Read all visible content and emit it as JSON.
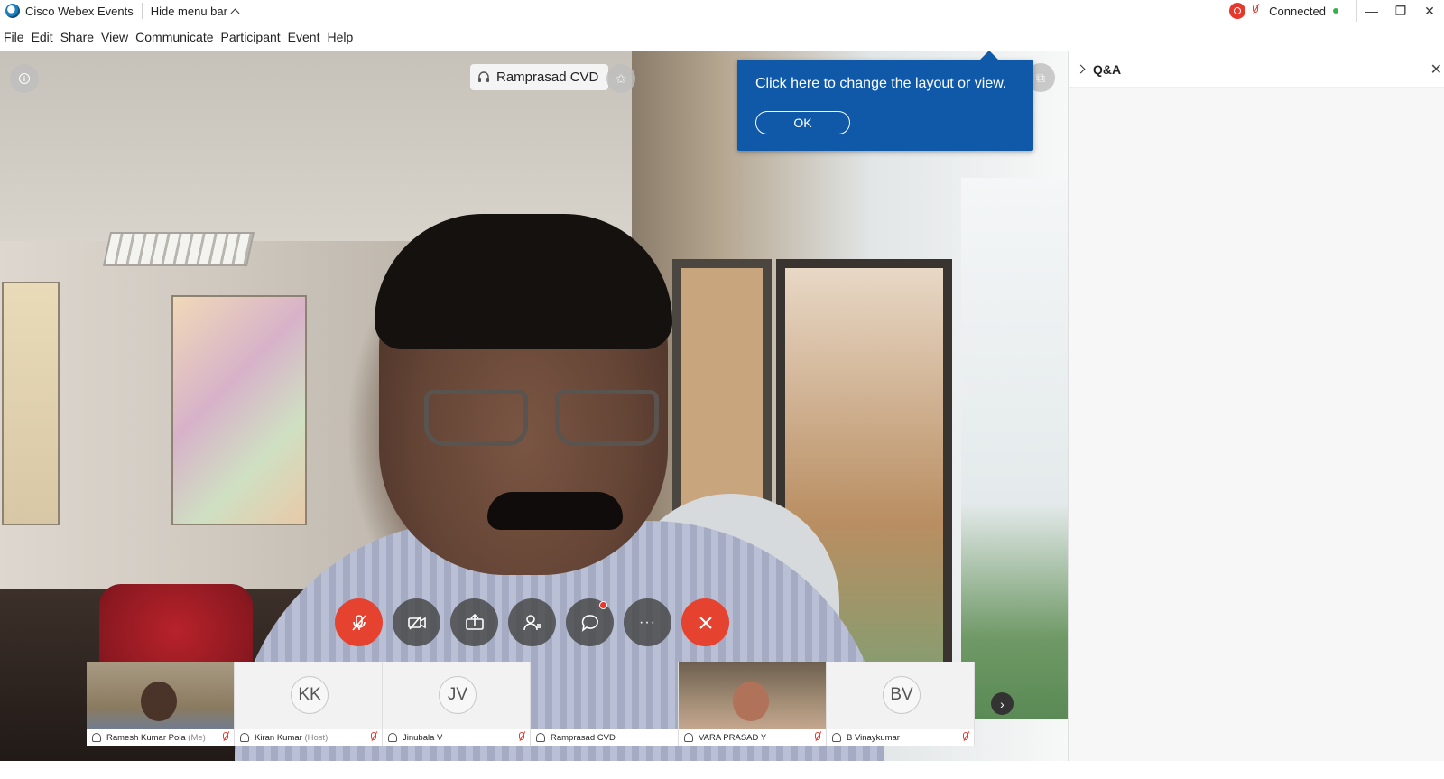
{
  "titlebar": {
    "app_title": "Cisco Webex Events",
    "hide_menu_label": "Hide menu bar",
    "status": "Connected",
    "status_color": "#36b24a",
    "recording_color": "#e5392d",
    "min_glyph": "—",
    "restore_glyph": "❐",
    "close_glyph": "✕"
  },
  "menubar": {
    "items": [
      "File",
      "Edit",
      "Share",
      "View",
      "Communicate",
      "Participant",
      "Event",
      "Help"
    ]
  },
  "stage": {
    "speaker_name": "Ramprasad CVD",
    "info_glyph": "i",
    "pin_glyph": "✩",
    "layout_glyph": "▭",
    "popout_glyph": "⧉"
  },
  "tooltip": {
    "text": "Click here to change the layout or view.",
    "ok_label": "OK",
    "bg_color": "#0f59a8"
  },
  "controls": {
    "icons": [
      "mic-muted-icon",
      "video-off-icon",
      "share-icon",
      "participants-icon",
      "chat-icon",
      "more-icon",
      "leave-icon"
    ],
    "more_glyph": "···",
    "accent_red": "#e5422f"
  },
  "thumbnails": [
    {
      "name": "Ramesh Kumar Pola",
      "role": "(Me)",
      "initials": "",
      "video": true
    },
    {
      "name": "Kiran Kumar",
      "role": "(Host)",
      "initials": "KK",
      "video": false
    },
    {
      "name": "Jinubala V",
      "role": "",
      "initials": "JV",
      "video": false
    },
    {
      "name": "Ramprasad CVD",
      "role": "",
      "initials": "",
      "video": false
    },
    {
      "name": "VARA PRASAD Y",
      "role": "",
      "initials": "",
      "video": true
    },
    {
      "name": "B Vinaykumar",
      "role": "",
      "initials": "BV",
      "video": false
    }
  ],
  "thumb_next_glyph": "›",
  "panel": {
    "title": "Q&A",
    "close_glyph": "✕"
  }
}
